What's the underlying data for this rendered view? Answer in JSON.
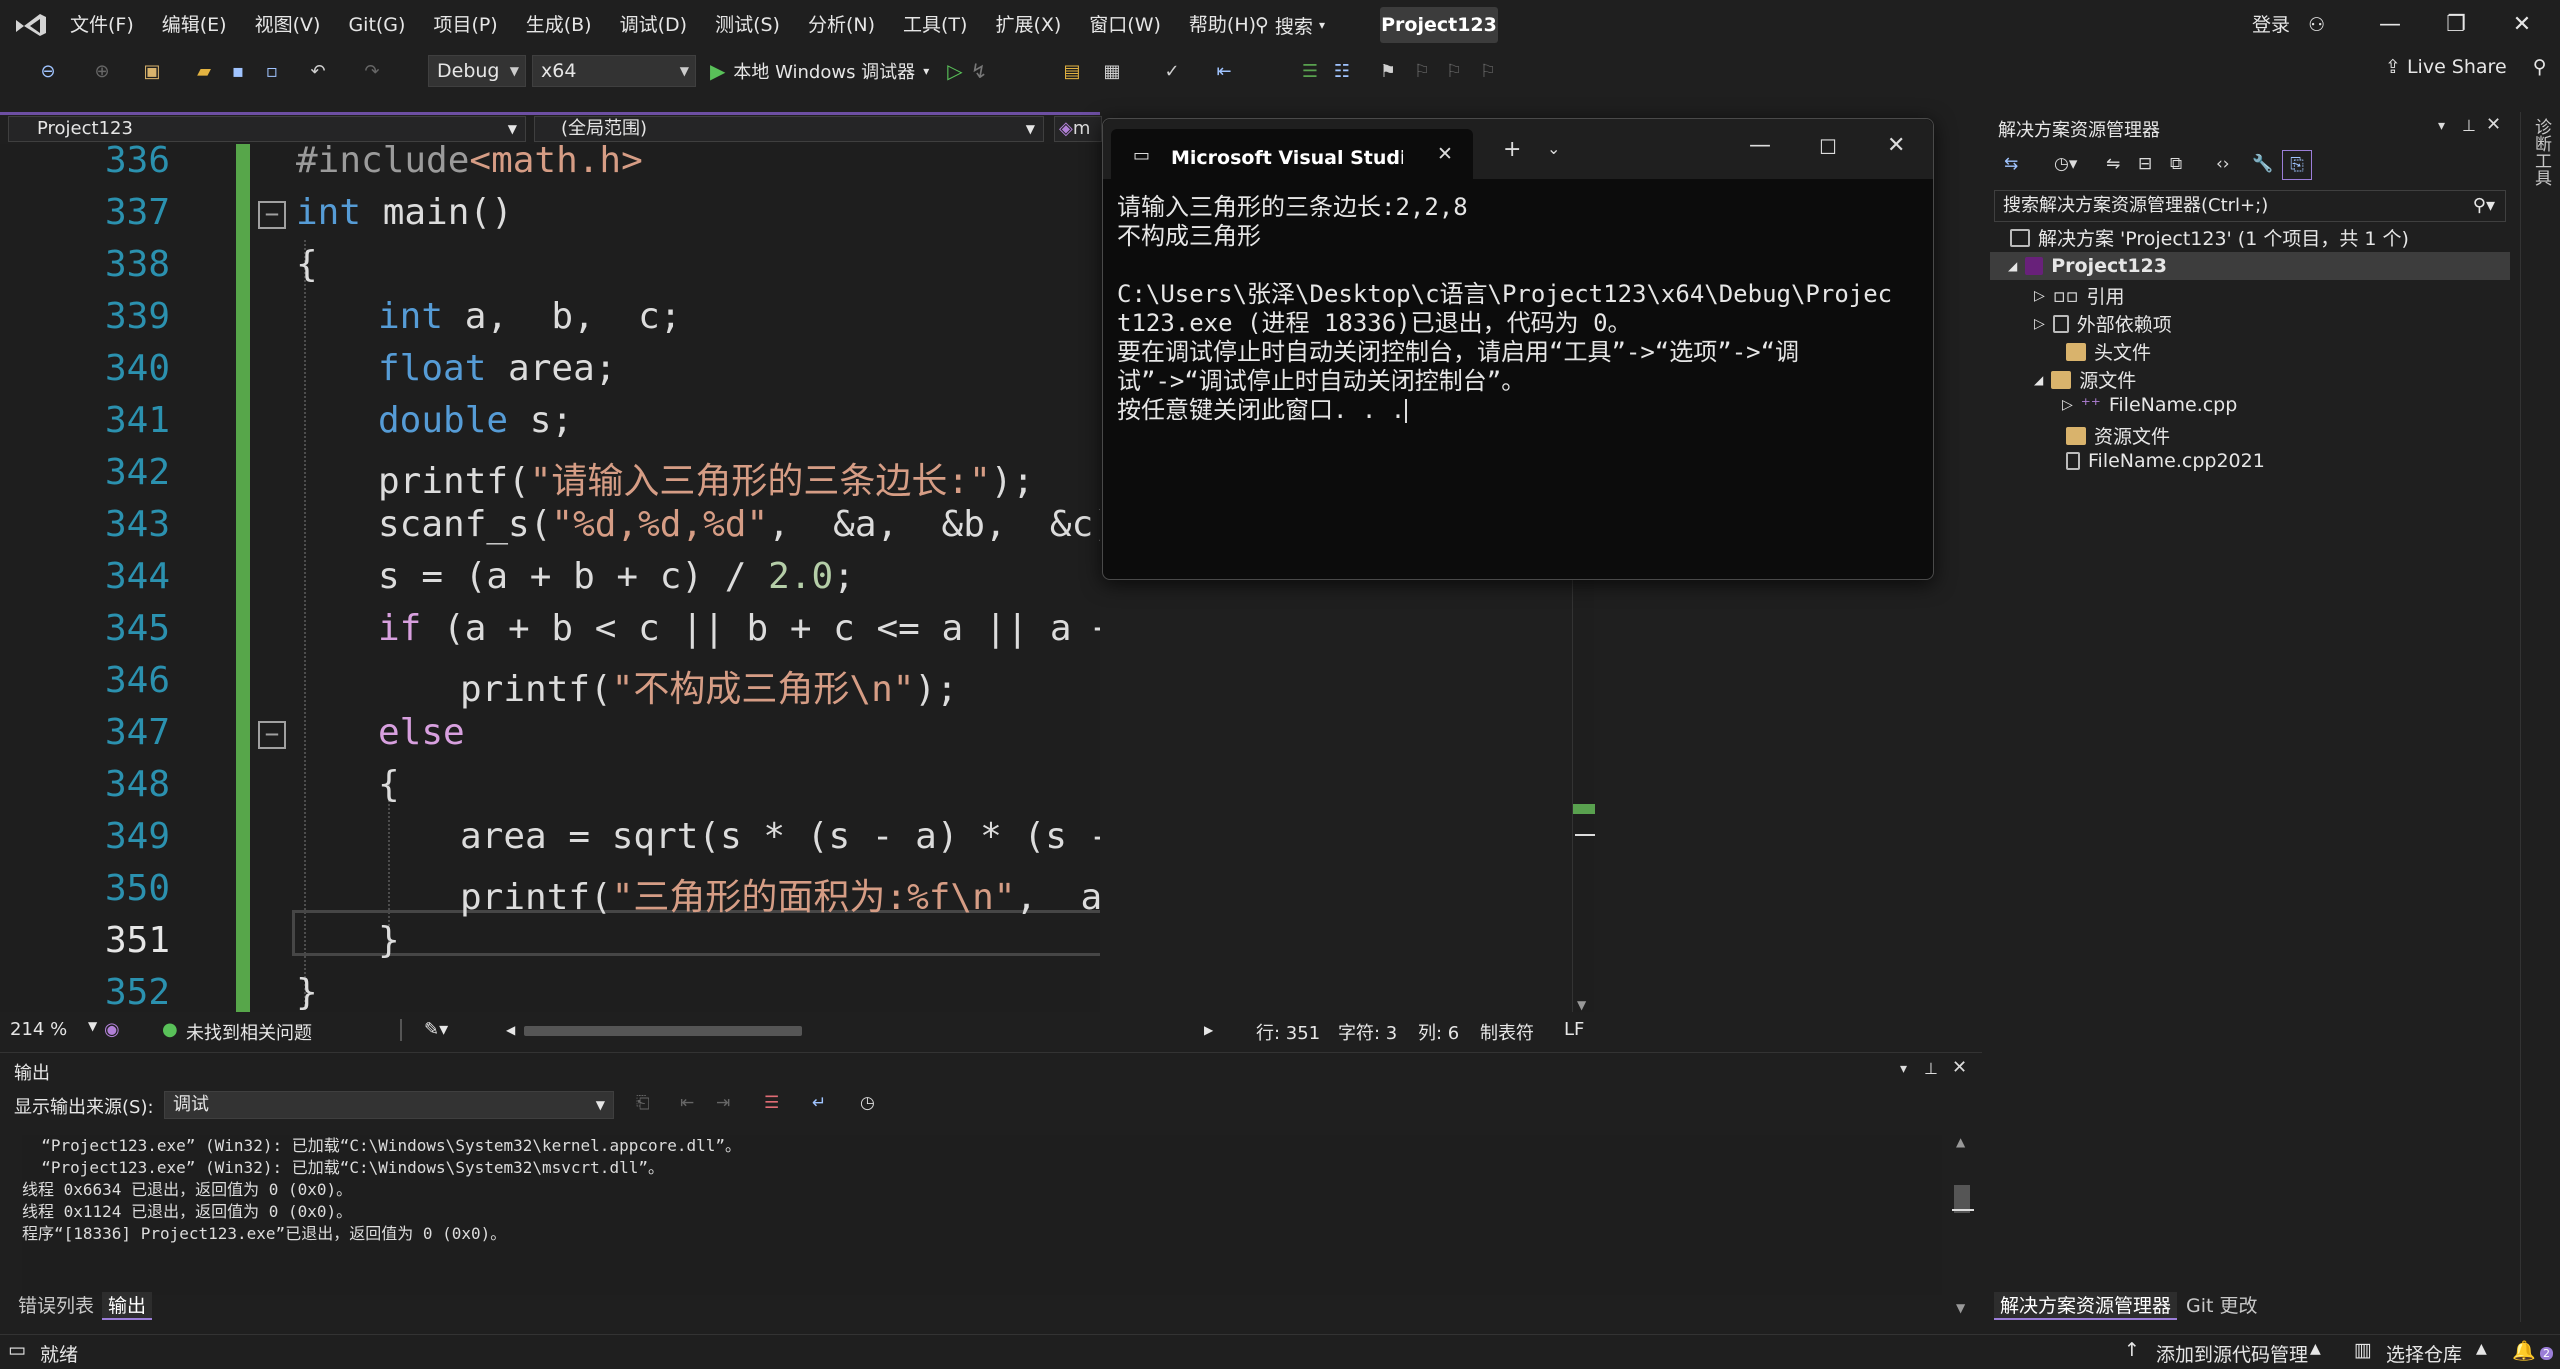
{
  "menubar": {
    "menus": [
      "文件(F)",
      "编辑(E)",
      "视图(V)",
      "Git(G)",
      "项目(P)",
      "生成(B)",
      "调试(D)",
      "测试(S)",
      "分析(N)",
      "工具(T)",
      "扩展(X)",
      "窗口(W)",
      "帮助(H)"
    ],
    "search_label": "搜索",
    "project_title": "Project123",
    "login_label": "登录"
  },
  "toolbar": {
    "config": "Debug",
    "platform": "x64",
    "run_label": "本地 Windows 调试器",
    "live_share": "Live Share"
  },
  "editor": {
    "project_dropdown": "Project123",
    "scope_dropdown": "(全局范围)",
    "member_dropdown_partial": "m",
    "line_numbers": [
      "336",
      "337",
      "338",
      "339",
      "340",
      "341",
      "342",
      "343",
      "344",
      "345",
      "346",
      "347",
      "348",
      "349",
      "350",
      "351",
      "352"
    ],
    "current_line": "351",
    "code": {
      "l336_pre": "#include",
      "l336_inc": "<math.h>",
      "l337_kw": "int",
      "l337_rest": " main()",
      "l338": "{",
      "l339_kw": "int",
      "l339_rest": " a,  b,  c;",
      "l340_kw": "float",
      "l340_rest": " area;",
      "l341_kw": "double",
      "l341_rest": " s;",
      "l342_a": "printf(",
      "l342_str": "\"请输入三角形的三条边长:\"",
      "l342_b": ");",
      "l343_a": "scanf_s(",
      "l343_str": "\"%d,%d,%d\"",
      "l343_b": ",  &a,  &b,  &c);",
      "l344_a": "s = (a + b + c) / ",
      "l344_num": "2.0",
      "l344_b": ";",
      "l345_kw": "if",
      "l345_rest": " (a + b < c || b + c <= a || a + c <= b)",
      "l346_a": "printf(",
      "l346_str": "\"不构成三角形\\n\"",
      "l346_b": ");",
      "l347_kw": "else",
      "l348": "{",
      "l349": "area = sqrt(s * (s - a) * (s - b) * (s - c));",
      "l350_a": "printf(",
      "l350_str": "\"三角形的面积为:%f\\n\"",
      "l350_b": ",  area);",
      "l351": "}",
      "l352": "}"
    }
  },
  "editor_status": {
    "zoom": "214 %",
    "issues": "未找到相关问题",
    "line": "行: 351",
    "char": "字符: 3",
    "col": "列: 6",
    "tabs": "制表符",
    "eol": "LF"
  },
  "console": {
    "title": "Microsoft Visual Studio 调试控",
    "lines": [
      "请输入三角形的三条边长:2,2,8",
      "不构成三角形",
      "",
      "C:\\Users\\张泽\\Desktop\\c语言\\Project123\\x64\\Debug\\Projec",
      "t123.exe (进程 18336)已退出，代码为 0。",
      "要在调试停止时自动关闭控制台，请启用“工具”->“选项”->“调",
      "试”->“调试停止时自动关闭控制台”。",
      "按任意键关闭此窗口. . ."
    ]
  },
  "solution_explorer": {
    "title": "解决方案资源管理器",
    "search_placeholder": "搜索解决方案资源管理器(Ctrl+;)",
    "items": [
      {
        "label": "解决方案 'Project123' (1 个项目，共 1 个)"
      },
      {
        "label": "Project123"
      },
      {
        "label": "引用"
      },
      {
        "label": "外部依赖项"
      },
      {
        "label": "头文件"
      },
      {
        "label": "源文件"
      },
      {
        "label": "FileName.cpp"
      },
      {
        "label": "资源文件"
      },
      {
        "label": "FileName.cpp2021"
      }
    ],
    "tabs": [
      "解决方案资源管理器",
      "Git 更改"
    ],
    "side_label": "诊断工具"
  },
  "output": {
    "title": "输出",
    "source_label": "显示输出来源(S):",
    "source_value": "调试",
    "lines": [
      "  “Project123.exe” (Win32): 已加载“C:\\Windows\\System32\\kernel.appcore.dll”。",
      "  “Project123.exe” (Win32): 已加载“C:\\Windows\\System32\\msvcrt.dll”。",
      "线程 0x6634 已退出，返回值为 0 (0x0)。",
      "线程 0x1124 已退出，返回值为 0 (0x0)。",
      "程序“[18336] Project123.exe”已退出，返回值为 0 (0x0)。"
    ],
    "tabs": [
      "错误列表",
      "输出"
    ]
  },
  "statusbar": {
    "ready": "就绪",
    "source_control": "添加到源代码管理",
    "repo": "选择仓库",
    "notifications": "2"
  }
}
